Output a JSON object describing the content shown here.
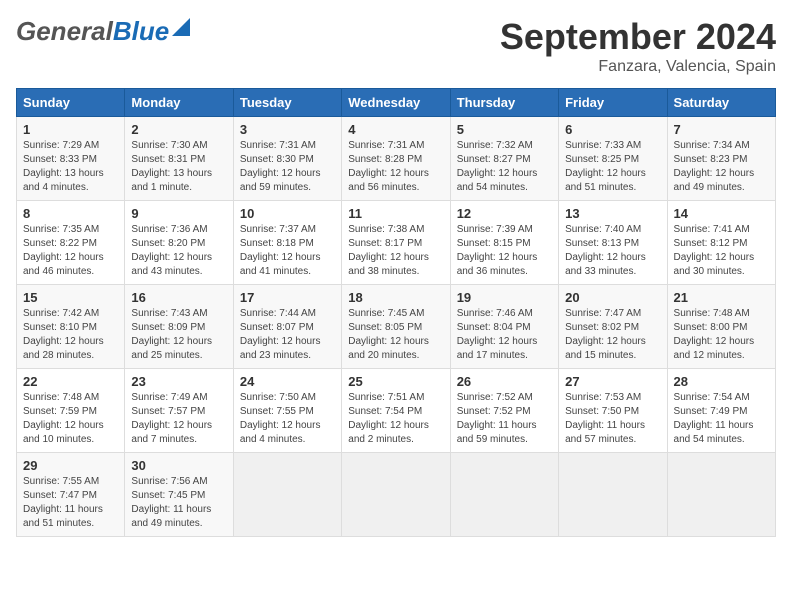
{
  "header": {
    "logo_general": "General",
    "logo_blue": "Blue",
    "month_title": "September 2024",
    "location": "Fanzara, Valencia, Spain"
  },
  "days_of_week": [
    "Sunday",
    "Monday",
    "Tuesday",
    "Wednesday",
    "Thursday",
    "Friday",
    "Saturday"
  ],
  "weeks": [
    [
      {
        "day": "1",
        "lines": [
          "Sunrise: 7:29 AM",
          "Sunset: 8:33 PM",
          "Daylight: 13 hours",
          "and 4 minutes."
        ]
      },
      {
        "day": "2",
        "lines": [
          "Sunrise: 7:30 AM",
          "Sunset: 8:31 PM",
          "Daylight: 13 hours",
          "and 1 minute."
        ]
      },
      {
        "day": "3",
        "lines": [
          "Sunrise: 7:31 AM",
          "Sunset: 8:30 PM",
          "Daylight: 12 hours",
          "and 59 minutes."
        ]
      },
      {
        "day": "4",
        "lines": [
          "Sunrise: 7:31 AM",
          "Sunset: 8:28 PM",
          "Daylight: 12 hours",
          "and 56 minutes."
        ]
      },
      {
        "day": "5",
        "lines": [
          "Sunrise: 7:32 AM",
          "Sunset: 8:27 PM",
          "Daylight: 12 hours",
          "and 54 minutes."
        ]
      },
      {
        "day": "6",
        "lines": [
          "Sunrise: 7:33 AM",
          "Sunset: 8:25 PM",
          "Daylight: 12 hours",
          "and 51 minutes."
        ]
      },
      {
        "day": "7",
        "lines": [
          "Sunrise: 7:34 AM",
          "Sunset: 8:23 PM",
          "Daylight: 12 hours",
          "and 49 minutes."
        ]
      }
    ],
    [
      {
        "day": "8",
        "lines": [
          "Sunrise: 7:35 AM",
          "Sunset: 8:22 PM",
          "Daylight: 12 hours",
          "and 46 minutes."
        ]
      },
      {
        "day": "9",
        "lines": [
          "Sunrise: 7:36 AM",
          "Sunset: 8:20 PM",
          "Daylight: 12 hours",
          "and 43 minutes."
        ]
      },
      {
        "day": "10",
        "lines": [
          "Sunrise: 7:37 AM",
          "Sunset: 8:18 PM",
          "Daylight: 12 hours",
          "and 41 minutes."
        ]
      },
      {
        "day": "11",
        "lines": [
          "Sunrise: 7:38 AM",
          "Sunset: 8:17 PM",
          "Daylight: 12 hours",
          "and 38 minutes."
        ]
      },
      {
        "day": "12",
        "lines": [
          "Sunrise: 7:39 AM",
          "Sunset: 8:15 PM",
          "Daylight: 12 hours",
          "and 36 minutes."
        ]
      },
      {
        "day": "13",
        "lines": [
          "Sunrise: 7:40 AM",
          "Sunset: 8:13 PM",
          "Daylight: 12 hours",
          "and 33 minutes."
        ]
      },
      {
        "day": "14",
        "lines": [
          "Sunrise: 7:41 AM",
          "Sunset: 8:12 PM",
          "Daylight: 12 hours",
          "and 30 minutes."
        ]
      }
    ],
    [
      {
        "day": "15",
        "lines": [
          "Sunrise: 7:42 AM",
          "Sunset: 8:10 PM",
          "Daylight: 12 hours",
          "and 28 minutes."
        ]
      },
      {
        "day": "16",
        "lines": [
          "Sunrise: 7:43 AM",
          "Sunset: 8:09 PM",
          "Daylight: 12 hours",
          "and 25 minutes."
        ]
      },
      {
        "day": "17",
        "lines": [
          "Sunrise: 7:44 AM",
          "Sunset: 8:07 PM",
          "Daylight: 12 hours",
          "and 23 minutes."
        ]
      },
      {
        "day": "18",
        "lines": [
          "Sunrise: 7:45 AM",
          "Sunset: 8:05 PM",
          "Daylight: 12 hours",
          "and 20 minutes."
        ]
      },
      {
        "day": "19",
        "lines": [
          "Sunrise: 7:46 AM",
          "Sunset: 8:04 PM",
          "Daylight: 12 hours",
          "and 17 minutes."
        ]
      },
      {
        "day": "20",
        "lines": [
          "Sunrise: 7:47 AM",
          "Sunset: 8:02 PM",
          "Daylight: 12 hours",
          "and 15 minutes."
        ]
      },
      {
        "day": "21",
        "lines": [
          "Sunrise: 7:48 AM",
          "Sunset: 8:00 PM",
          "Daylight: 12 hours",
          "and 12 minutes."
        ]
      }
    ],
    [
      {
        "day": "22",
        "lines": [
          "Sunrise: 7:48 AM",
          "Sunset: 7:59 PM",
          "Daylight: 12 hours",
          "and 10 minutes."
        ]
      },
      {
        "day": "23",
        "lines": [
          "Sunrise: 7:49 AM",
          "Sunset: 7:57 PM",
          "Daylight: 12 hours",
          "and 7 minutes."
        ]
      },
      {
        "day": "24",
        "lines": [
          "Sunrise: 7:50 AM",
          "Sunset: 7:55 PM",
          "Daylight: 12 hours",
          "and 4 minutes."
        ]
      },
      {
        "day": "25",
        "lines": [
          "Sunrise: 7:51 AM",
          "Sunset: 7:54 PM",
          "Daylight: 12 hours",
          "and 2 minutes."
        ]
      },
      {
        "day": "26",
        "lines": [
          "Sunrise: 7:52 AM",
          "Sunset: 7:52 PM",
          "Daylight: 11 hours",
          "and 59 minutes."
        ]
      },
      {
        "day": "27",
        "lines": [
          "Sunrise: 7:53 AM",
          "Sunset: 7:50 PM",
          "Daylight: 11 hours",
          "and 57 minutes."
        ]
      },
      {
        "day": "28",
        "lines": [
          "Sunrise: 7:54 AM",
          "Sunset: 7:49 PM",
          "Daylight: 11 hours",
          "and 54 minutes."
        ]
      }
    ],
    [
      {
        "day": "29",
        "lines": [
          "Sunrise: 7:55 AM",
          "Sunset: 7:47 PM",
          "Daylight: 11 hours",
          "and 51 minutes."
        ]
      },
      {
        "day": "30",
        "lines": [
          "Sunrise: 7:56 AM",
          "Sunset: 7:45 PM",
          "Daylight: 11 hours",
          "and 49 minutes."
        ]
      },
      {
        "day": "",
        "lines": []
      },
      {
        "day": "",
        "lines": []
      },
      {
        "day": "",
        "lines": []
      },
      {
        "day": "",
        "lines": []
      },
      {
        "day": "",
        "lines": []
      }
    ]
  ]
}
